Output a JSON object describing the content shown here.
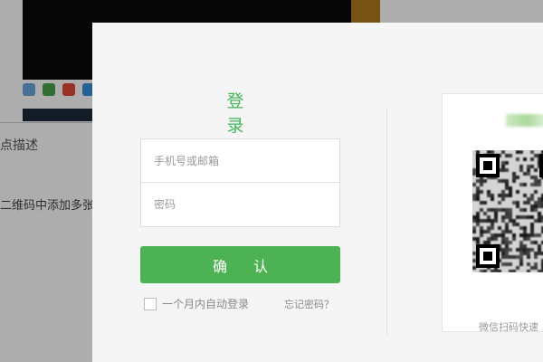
{
  "background": {
    "text_1": "点描述",
    "text_2": "二维码中添加多张"
  },
  "login": {
    "title": "登录",
    "phone_placeholder": "手机号或邮箱",
    "password_placeholder": "密码",
    "confirm_label": "确 认",
    "remember_label": "一个月内自动登录",
    "forgot_label": "忘记密码？"
  },
  "qr": {
    "caption": "微信扫码快速"
  },
  "colors": {
    "brand_green": "#4cb253",
    "title_green": "#42b65a",
    "modal_bg": "#f5f5f5"
  }
}
